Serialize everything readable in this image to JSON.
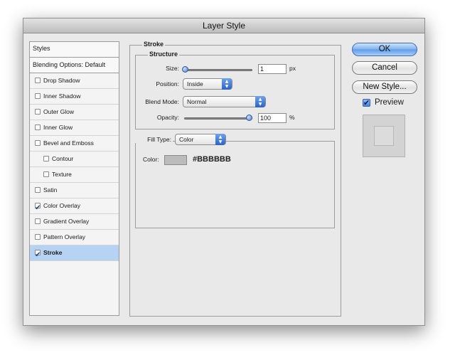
{
  "window": {
    "title": "Layer Style"
  },
  "styles_list": {
    "header": "Styles",
    "blending": "Blending Options: Default",
    "items": [
      {
        "label": "Drop Shadow",
        "checked": false,
        "indent": false
      },
      {
        "label": "Inner Shadow",
        "checked": false,
        "indent": false
      },
      {
        "label": "Outer Glow",
        "checked": false,
        "indent": false
      },
      {
        "label": "Inner Glow",
        "checked": false,
        "indent": false
      },
      {
        "label": "Bevel and Emboss",
        "checked": false,
        "indent": false
      },
      {
        "label": "Contour",
        "checked": false,
        "indent": true
      },
      {
        "label": "Texture",
        "checked": false,
        "indent": true
      },
      {
        "label": "Satin",
        "checked": false,
        "indent": false
      },
      {
        "label": "Color Overlay",
        "checked": true,
        "indent": false
      },
      {
        "label": "Gradient Overlay",
        "checked": false,
        "indent": false
      },
      {
        "label": "Pattern Overlay",
        "checked": false,
        "indent": false
      },
      {
        "label": "Stroke",
        "checked": true,
        "indent": false,
        "selected": true
      }
    ]
  },
  "stroke": {
    "title": "Stroke",
    "structure": {
      "title": "Structure",
      "size_label": "Size:",
      "size_value": "1",
      "size_unit": "px",
      "size_fraction": 0.0,
      "position_label": "Position:",
      "position_value": "Inside",
      "blend_label": "Blend Mode:",
      "blend_value": "Normal",
      "opacity_label": "Opacity:",
      "opacity_value": "100",
      "opacity_unit": "%",
      "opacity_fraction": 1.0
    },
    "fill": {
      "type_label": "Fill Type:",
      "type_value": "Color",
      "color_label": "Color:",
      "color_hex": "#BBBBBB"
    }
  },
  "buttons": {
    "ok": "OK",
    "cancel": "Cancel",
    "new_style": "New Style...",
    "preview_label": "Preview",
    "preview_checked": true
  },
  "colors": {
    "selected_row": "#b7d3f3",
    "accent": "#5e9ae8"
  }
}
